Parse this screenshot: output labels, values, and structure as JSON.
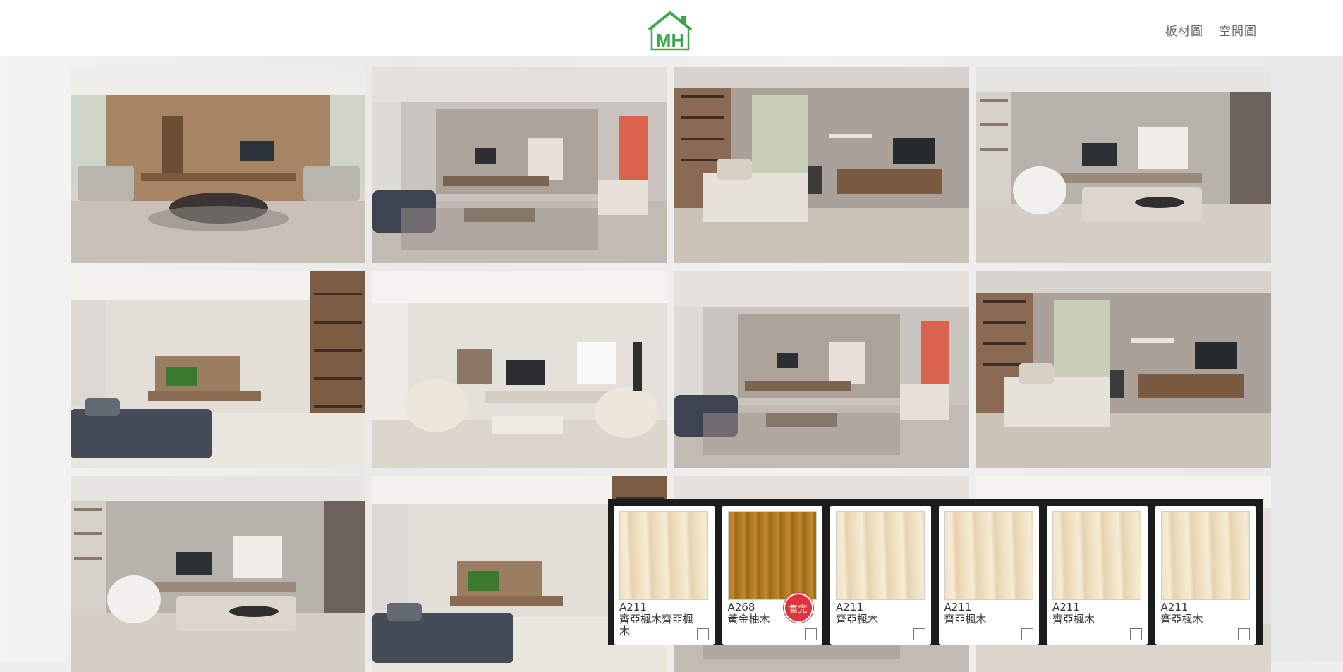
{
  "header": {
    "logo_text": "MH",
    "nav": [
      "板材圖",
      "空間圖"
    ]
  },
  "gallery": {
    "tiles": [
      {
        "scene": "living-room-warm-wood"
      },
      {
        "scene": "living-room-grey-sofa"
      },
      {
        "scene": "living-room-bookshelf-daybed"
      },
      {
        "scene": "living-room-white-chair"
      },
      {
        "scene": "living-room-tall-bookcase"
      },
      {
        "scene": "living-room-round-chairs"
      },
      {
        "scene": "living-room-grey-sofa"
      },
      {
        "scene": "living-room-bookshelf-daybed"
      },
      {
        "scene": "living-room-white-chair"
      },
      {
        "scene": "living-room-tall-bookcase"
      },
      {
        "scene": "living-room-grey-sofa"
      },
      {
        "scene": "living-room-round-chairs"
      }
    ]
  },
  "tray": {
    "swatches": [
      {
        "code": "A211",
        "name": "齊亞楓木齊亞楓木",
        "color": "#efe0c2",
        "sold_out": false
      },
      {
        "code": "A268",
        "name": "黃金柚木",
        "color": "#b07a22",
        "sold_out": true,
        "badge": "售完"
      },
      {
        "code": "A211",
        "name": "齊亞楓木",
        "color": "#efe0c2",
        "sold_out": false
      },
      {
        "code": "A211",
        "name": "齊亞楓木",
        "color": "#efe0c2",
        "sold_out": false
      },
      {
        "code": "A211",
        "name": "齊亞楓木",
        "color": "#efe0c2",
        "sold_out": false
      },
      {
        "code": "A211",
        "name": "齊亞楓木",
        "color": "#efe0c2",
        "sold_out": false
      }
    ]
  },
  "colors": {
    "brand_green": "#3ea64a",
    "sold_badge": "#e0333d"
  }
}
